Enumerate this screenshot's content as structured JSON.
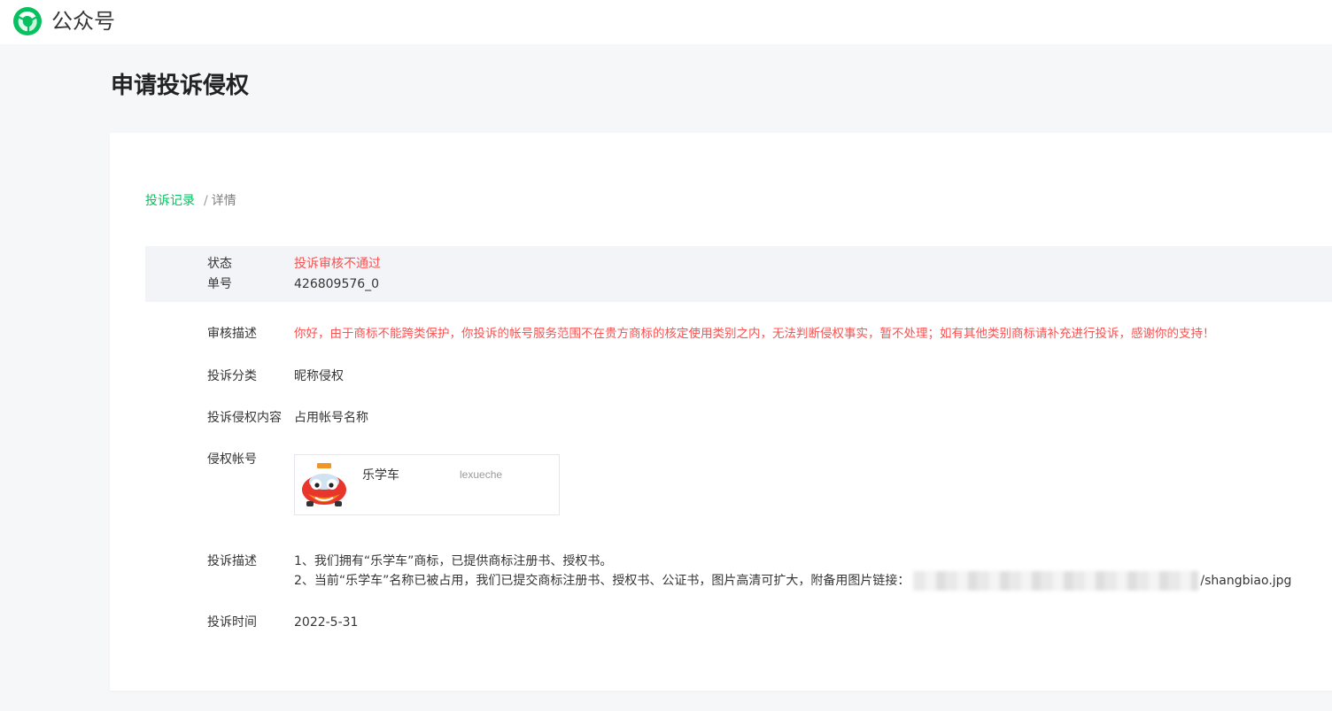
{
  "header": {
    "brand": "公众号",
    "logo_icon": "wechat-official-account-logo"
  },
  "page": {
    "title": "申请投诉侵权"
  },
  "breadcrumb": {
    "parent": "投诉记录",
    "separator": "/",
    "current": "详情"
  },
  "status": {
    "state_label": "状态",
    "state_value": "投诉审核不通过",
    "order_label": "单号",
    "order_value": "426809576_0"
  },
  "details": {
    "review_label": "审核描述",
    "review_value": "你好，由于商标不能跨类保护，你投诉的帐号服务范围不在贵方商标的核定使用类别之内，无法判断侵权事实，暂不处理；如有其他类别商标请补充进行投诉，感谢你的支持！",
    "category_label": "投诉分类",
    "category_value": "昵称侵权",
    "content_label": "投诉侵权内容",
    "content_value": "占用帐号名称",
    "account_label": "侵权帐号",
    "account": {
      "name": "乐学车",
      "id": "lexueche",
      "avatar_icon": "car-mascot-avatar"
    },
    "desc_label": "投诉描述",
    "desc_line1": "1、我们拥有“乐学车”商标，已提供商标注册书、授权书。",
    "desc_line2_prefix": "2、当前“乐学车”名称已被占用，我们已提交商标注册书、授权书、公证书，图片高清可扩大，附备用图片链接：",
    "desc_line2_suffix": "/shangbiao.jpg",
    "time_label": "投诉时间",
    "time_value": "2022-5-31"
  },
  "colors": {
    "accent": "#07c160",
    "error": "#fa5151"
  }
}
